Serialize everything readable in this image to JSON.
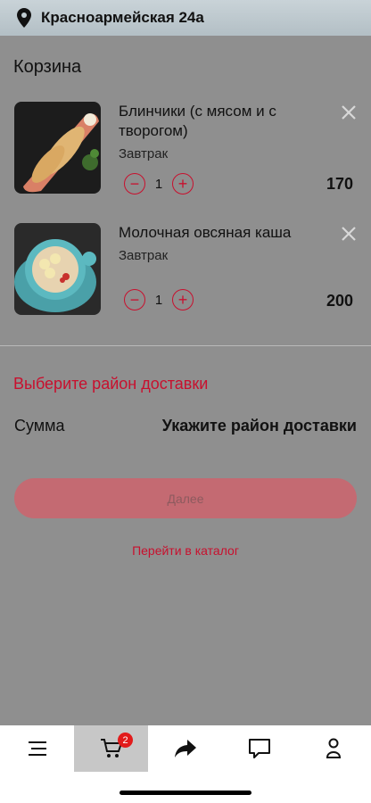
{
  "header": {
    "address": "Красноармейская 24а",
    "icon": "location-pin-icon"
  },
  "cart": {
    "title": "Корзина",
    "items": [
      {
        "name": "Блинчики (с мясом и с творогом)",
        "category": "Завтрак",
        "quantity": "1",
        "price": "170",
        "image": "crepes-image"
      },
      {
        "name": "Молочная овсяная каша",
        "category": "Завтрак",
        "quantity": "1",
        "price": "200",
        "image": "oatmeal-image"
      }
    ],
    "minus": "−",
    "plus": "+"
  },
  "delivery": {
    "district_prompt": "Выберите район доставки",
    "sum_label": "Сумма",
    "sum_value": "Укажите район доставки"
  },
  "actions": {
    "next_label": "Далее",
    "catalog_link": "Перейти в каталог"
  },
  "tabbar": {
    "tabs": [
      {
        "icon": "menu-icon"
      },
      {
        "icon": "cart-icon",
        "badge": "2",
        "active": true
      },
      {
        "icon": "share-icon"
      },
      {
        "icon": "chat-icon"
      },
      {
        "icon": "profile-icon"
      }
    ]
  },
  "colors": {
    "accent": "#c8102e",
    "overlay": "#8f8f8f",
    "button_disabled": "#c46a72"
  }
}
